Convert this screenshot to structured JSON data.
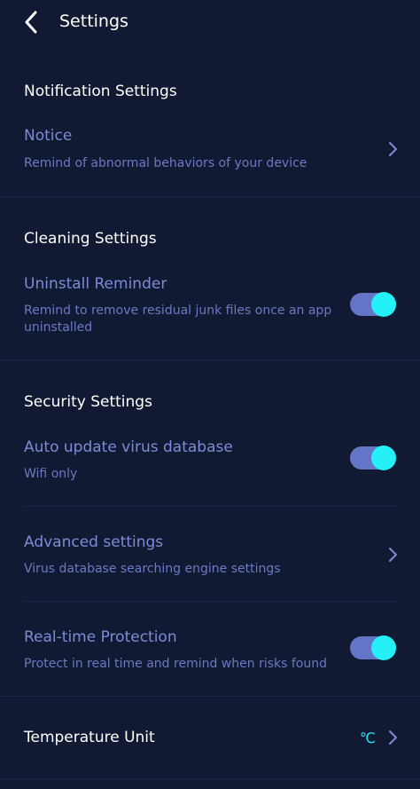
{
  "header": {
    "title": "Settings"
  },
  "sections": {
    "notification": {
      "title": "Notification Settings",
      "notice": {
        "title": "Notice",
        "subtitle": "Remind of abnormal behaviors of your device"
      }
    },
    "cleaning": {
      "title": "Cleaning Settings",
      "uninstall_reminder": {
        "title": "Uninstall Reminder",
        "subtitle": "Remind to remove residual junk files once an app uninstalled",
        "enabled": true
      }
    },
    "security": {
      "title": "Security Settings",
      "auto_update": {
        "title": "Auto update virus database",
        "subtitle": "Wifi only",
        "enabled": true
      },
      "advanced": {
        "title": "Advanced settings",
        "subtitle": "Virus database searching engine settings"
      },
      "realtime": {
        "title": "Real-time Protection",
        "subtitle": "Protect in real time and remind when risks found",
        "enabled": true
      }
    },
    "temperature": {
      "title": "Temperature Unit",
      "value": "℃"
    }
  },
  "colors": {
    "background": "#121a33",
    "item_title": "#7d8bd6",
    "item_subtitle": "#6b79c2",
    "toggle_track": "#6474c6",
    "toggle_knob": "#25f0f5",
    "accent_value": "#29e6f2"
  }
}
